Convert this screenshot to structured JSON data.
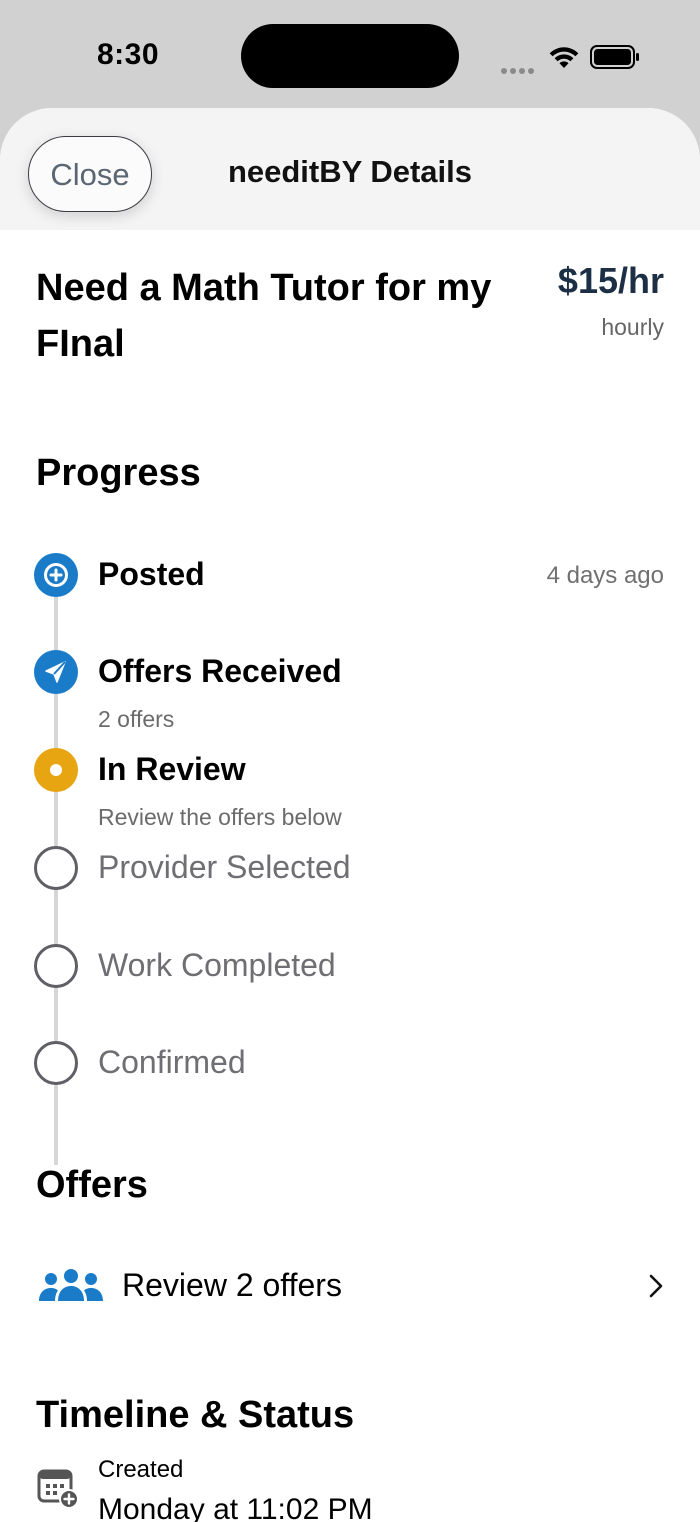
{
  "status_bar": {
    "time": "8:30"
  },
  "header": {
    "close_label": "Close",
    "title": "needitBY Details"
  },
  "job": {
    "title": "Need a Math Tutor for my FInal",
    "price": "$15/hr",
    "price_unit": "hourly"
  },
  "progress": {
    "heading": "Progress",
    "steps": [
      {
        "label": "Posted",
        "time": "4 days ago",
        "sub": "",
        "state": "done",
        "icon": "plus-circle-icon"
      },
      {
        "label": "Offers Received",
        "time": "",
        "sub": "2 offers",
        "state": "done",
        "icon": "paper-plane-icon"
      },
      {
        "label": "In Review",
        "time": "",
        "sub": "Review the offers below",
        "state": "current",
        "icon": "dot-icon"
      },
      {
        "label": "Provider Selected",
        "time": "",
        "sub": "",
        "state": "pending",
        "icon": "empty-circle-icon"
      },
      {
        "label": "Work Completed",
        "time": "",
        "sub": "",
        "state": "pending",
        "icon": "empty-circle-icon"
      },
      {
        "label": "Confirmed",
        "time": "",
        "sub": "",
        "state": "pending",
        "icon": "empty-circle-icon"
      }
    ]
  },
  "offers": {
    "heading": "Offers",
    "review_label": "Review 2 offers",
    "icon": "people-icon"
  },
  "timeline": {
    "heading": "Timeline & Status",
    "created_label": "Created",
    "created_value": "Monday at 11:02 PM",
    "icon": "calendar-icon"
  },
  "colors": {
    "accent_blue": "#1a7bc9",
    "review_yellow": "#e8a512",
    "price_navy": "#1c2f45"
  }
}
